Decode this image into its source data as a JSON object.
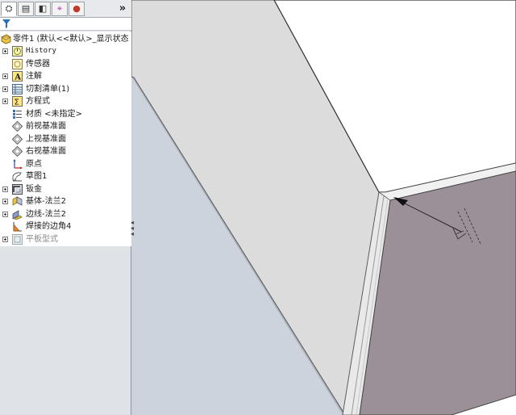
{
  "tabs": [
    {
      "name": "feature-manager-tab",
      "icon": "feature-tree-icon",
      "glyph": "⛭",
      "active": true
    },
    {
      "name": "property-manager-tab",
      "icon": "property-icon",
      "glyph": "▤",
      "active": false
    },
    {
      "name": "configuration-manager-tab",
      "icon": "configuration-icon",
      "glyph": "◧",
      "active": false
    },
    {
      "name": "dimxpert-tab",
      "icon": "crosshair-icon",
      "glyph": "⌖",
      "active": false
    },
    {
      "name": "display-manager-tab",
      "icon": "appearance-icon",
      "glyph": "●",
      "active": false
    }
  ],
  "tabs_expand": "»",
  "filter": {
    "placeholder": ""
  },
  "tree": {
    "root": {
      "label": "零件1  (默认<<默认>_显示状态"
    },
    "items": [
      {
        "label": "History",
        "expander": true,
        "icon": "history-icon",
        "mono": true
      },
      {
        "label": "传感器",
        "expander": false,
        "icon": "sensor-icon"
      },
      {
        "label": "注解",
        "expander": true,
        "icon": "annotation-icon",
        "glyph": "A"
      },
      {
        "label": "切割清单(1)",
        "expander": true,
        "icon": "cut-list-icon"
      },
      {
        "label": "方程式",
        "expander": true,
        "icon": "equation-icon",
        "glyph": "Σ"
      },
      {
        "label": "材质 <未指定>",
        "expander": false,
        "icon": "material-icon"
      },
      {
        "label": "前视基准面",
        "expander": false,
        "icon": "plane-icon"
      },
      {
        "label": "上视基准面",
        "expander": false,
        "icon": "plane-icon"
      },
      {
        "label": "右视基准面",
        "expander": false,
        "icon": "plane-icon"
      },
      {
        "label": "原点",
        "expander": false,
        "icon": "origin-icon"
      },
      {
        "label": "草图1",
        "expander": false,
        "icon": "sketch-icon"
      },
      {
        "label": "钣金",
        "expander": true,
        "icon": "sheet-metal-icon"
      },
      {
        "label": "基体-法兰2",
        "expander": true,
        "icon": "base-flange-icon"
      },
      {
        "label": "边线-法兰2",
        "expander": true,
        "icon": "edge-flange-icon"
      },
      {
        "label": "焊接的边角4",
        "expander": false,
        "icon": "welded-corner-icon"
      },
      {
        "label": "平板型式",
        "expander": true,
        "icon": "flat-pattern-icon",
        "disabled": true
      }
    ]
  },
  "colors": {
    "panel_bg": "#dfe3e8",
    "part_face_light": "#ffffff",
    "part_face_grey": "#dcdcdc",
    "part_face_dark": "#9b9098",
    "background_band": "#ccd3dc"
  }
}
